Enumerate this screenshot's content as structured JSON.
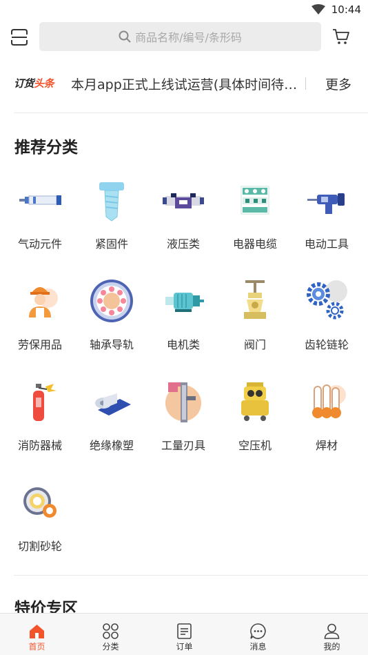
{
  "status_bar": {
    "time": "10:44"
  },
  "search": {
    "placeholder": "商品名称/编号/条形码"
  },
  "news": {
    "logo_part1": "订货",
    "logo_part2": "头条",
    "headline": "本月app正式上线试运营(具体时间待…",
    "more": "更多"
  },
  "recommended": {
    "title": "推荐分类",
    "categories": [
      {
        "label": "气动元件",
        "icon": "pneumatic-cylinder-icon"
      },
      {
        "label": "紧固件",
        "icon": "screw-icon"
      },
      {
        "label": "液压类",
        "icon": "hydraulic-valve-icon"
      },
      {
        "label": "电器电缆",
        "icon": "electrical-panel-icon"
      },
      {
        "label": "电动工具",
        "icon": "power-drill-icon"
      },
      {
        "label": "劳保用品",
        "icon": "worker-icon"
      },
      {
        "label": "轴承导轨",
        "icon": "bearing-icon"
      },
      {
        "label": "电机类",
        "icon": "motor-icon"
      },
      {
        "label": "阀门",
        "icon": "valve-icon"
      },
      {
        "label": "齿轮链轮",
        "icon": "gears-icon"
      },
      {
        "label": "消防器械",
        "icon": "fire-extinguisher-icon"
      },
      {
        "label": "绝缘橡塑",
        "icon": "insulation-roll-icon"
      },
      {
        "label": "工量刃具",
        "icon": "caliper-icon"
      },
      {
        "label": "空压机",
        "icon": "air-compressor-icon"
      },
      {
        "label": "焊材",
        "icon": "welding-rod-icon"
      },
      {
        "label": "切割砂轮",
        "icon": "cutting-wheel-icon"
      }
    ]
  },
  "special": {
    "title": "特价专区"
  },
  "tabbar": {
    "tabs": [
      {
        "label": "首页",
        "icon": "home-icon",
        "active": true
      },
      {
        "label": "分类",
        "icon": "category-icon",
        "active": false
      },
      {
        "label": "订单",
        "icon": "order-icon",
        "active": false
      },
      {
        "label": "消息",
        "icon": "message-icon",
        "active": false
      },
      {
        "label": "我的",
        "icon": "profile-icon",
        "active": false
      }
    ]
  },
  "colors": {
    "accent": "#f2552c",
    "search_bg": "#ececec",
    "tabbar_bg": "#f7f7f7"
  }
}
